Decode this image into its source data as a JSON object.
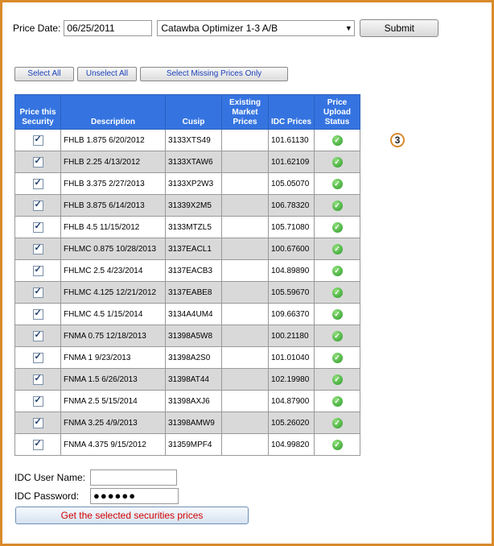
{
  "form": {
    "price_date_label": "Price Date:",
    "price_date_value": "06/25/2011",
    "portfolio_selected": "Catawba Optimizer 1-3 A/B",
    "submit_label": "Submit"
  },
  "selection_buttons": {
    "select_all": "Select All",
    "unselect_all": "Unselect All",
    "select_missing": "Select Missing Prices Only"
  },
  "table": {
    "headers": [
      "Price this Security",
      "Description",
      "Cusip",
      "Existing Market Prices",
      "IDC Prices",
      "Price Upload Status"
    ],
    "rows": [
      {
        "checked": true,
        "description": "FHLB 1.875 6/20/2012",
        "cusip": "3133XTS49",
        "existing": "",
        "idc": "101.61130",
        "status": "ok"
      },
      {
        "checked": true,
        "description": "FHLB 2.25 4/13/2012",
        "cusip": "3133XTAW6",
        "existing": "",
        "idc": "101.62109",
        "status": "ok"
      },
      {
        "checked": true,
        "description": "FHLB 3.375 2/27/2013",
        "cusip": "3133XP2W3",
        "existing": "",
        "idc": "105.05070",
        "status": "ok"
      },
      {
        "checked": true,
        "description": "FHLB 3.875 6/14/2013",
        "cusip": "31339X2M5",
        "existing": "",
        "idc": "106.78320",
        "status": "ok"
      },
      {
        "checked": true,
        "description": "FHLB 4.5 11/15/2012",
        "cusip": "3133MTZL5",
        "existing": "",
        "idc": "105.71080",
        "status": "ok"
      },
      {
        "checked": true,
        "description": "FHLMC 0.875 10/28/2013",
        "cusip": "3137EACL1",
        "existing": "",
        "idc": "100.67600",
        "status": "ok"
      },
      {
        "checked": true,
        "description": "FHLMC 2.5 4/23/2014",
        "cusip": "3137EACB3",
        "existing": "",
        "idc": "104.89890",
        "status": "ok"
      },
      {
        "checked": true,
        "description": "FHLMC 4.125 12/21/2012",
        "cusip": "3137EABE8",
        "existing": "",
        "idc": "105.59670",
        "status": "ok"
      },
      {
        "checked": true,
        "description": "FHLMC 4.5 1/15/2014",
        "cusip": "3134A4UM4",
        "existing": "",
        "idc": "109.66370",
        "status": "ok"
      },
      {
        "checked": true,
        "description": "FNMA 0.75 12/18/2013",
        "cusip": "31398A5W8",
        "existing": "",
        "idc": "100.21180",
        "status": "ok"
      },
      {
        "checked": true,
        "description": "FNMA 1 9/23/2013",
        "cusip": "31398A2S0",
        "existing": "",
        "idc": "101.01040",
        "status": "ok"
      },
      {
        "checked": true,
        "description": "FNMA 1.5 6/26/2013",
        "cusip": "31398AT44",
        "existing": "",
        "idc": "102.19980",
        "status": "ok"
      },
      {
        "checked": true,
        "description": "FNMA 2.5 5/15/2014",
        "cusip": "31398AXJ6",
        "existing": "",
        "idc": "104.87900",
        "status": "ok"
      },
      {
        "checked": true,
        "description": "FNMA 3.25 4/9/2013",
        "cusip": "31398AMW9",
        "existing": "",
        "idc": "105.26020",
        "status": "ok"
      },
      {
        "checked": true,
        "description": "FNMA 4.375 9/15/2012",
        "cusip": "31359MPF4",
        "existing": "",
        "idc": "104.99820",
        "status": "ok"
      }
    ]
  },
  "annotation": {
    "step_number": "3"
  },
  "login": {
    "user_label": "IDC User Name:",
    "user_value": "",
    "password_label": "IDC Password:",
    "password_mask": "●●●●●●"
  },
  "get_prices_label": "Get the selected securities prices",
  "colors": {
    "header_blue": "#3574e0",
    "frame_orange": "#d98a2b",
    "alt_row": "#d9d9d9",
    "action_red": "#d20000"
  }
}
